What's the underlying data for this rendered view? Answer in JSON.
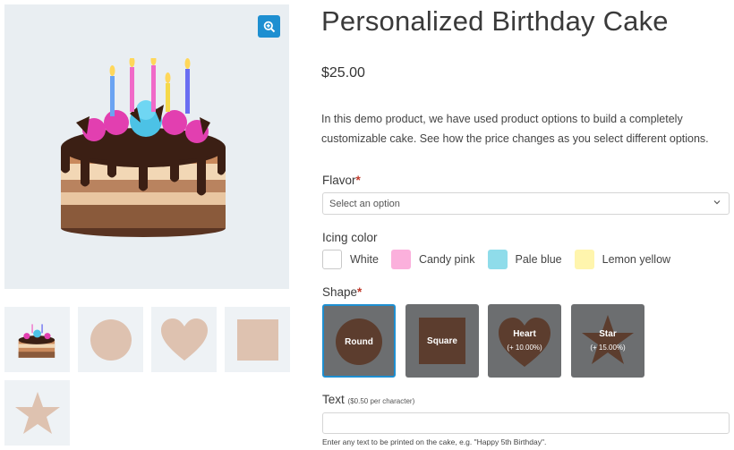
{
  "product": {
    "title": "Personalized Birthday Cake",
    "price": "$25.00",
    "description": "In this demo product, we have used product options to build a completely customizable cake. See how the price changes as you select different options."
  },
  "gallery": {
    "zoom_icon": "zoom-in-icon",
    "thumbnails": [
      "cake",
      "circle",
      "heart",
      "square",
      "star"
    ],
    "thumb_color": "#dec2b0"
  },
  "flavor": {
    "label": "Flavor",
    "required_mark": "*",
    "placeholder": "Select an option"
  },
  "icing": {
    "label": "Icing color",
    "options": [
      {
        "name": "White",
        "color": "#ffffff"
      },
      {
        "name": "Candy pink",
        "color": "#fbb0dc"
      },
      {
        "name": "Pale blue",
        "color": "#8fdcea"
      },
      {
        "name": "Lemon yellow",
        "color": "#fff5ad"
      }
    ]
  },
  "shape": {
    "label": "Shape",
    "required_mark": "*",
    "selected": "Round",
    "options": [
      {
        "name": "Round",
        "price": ""
      },
      {
        "name": "Square",
        "price": ""
      },
      {
        "name": "Heart",
        "price": "(+ 10.00%)"
      },
      {
        "name": "Star",
        "price": "(+ 15.00%)"
      }
    ]
  },
  "text_field": {
    "label": "Text",
    "price_note": "($0.50 per character)",
    "help": "Enter any text to be printed on the cake, e.g. \"Happy 5th Birthday\"."
  },
  "colors": {
    "accent": "#1e8fd1",
    "shape_bg": "#6c6e70",
    "shape_fill": "#5c3d2e",
    "required": "#c0392b"
  }
}
